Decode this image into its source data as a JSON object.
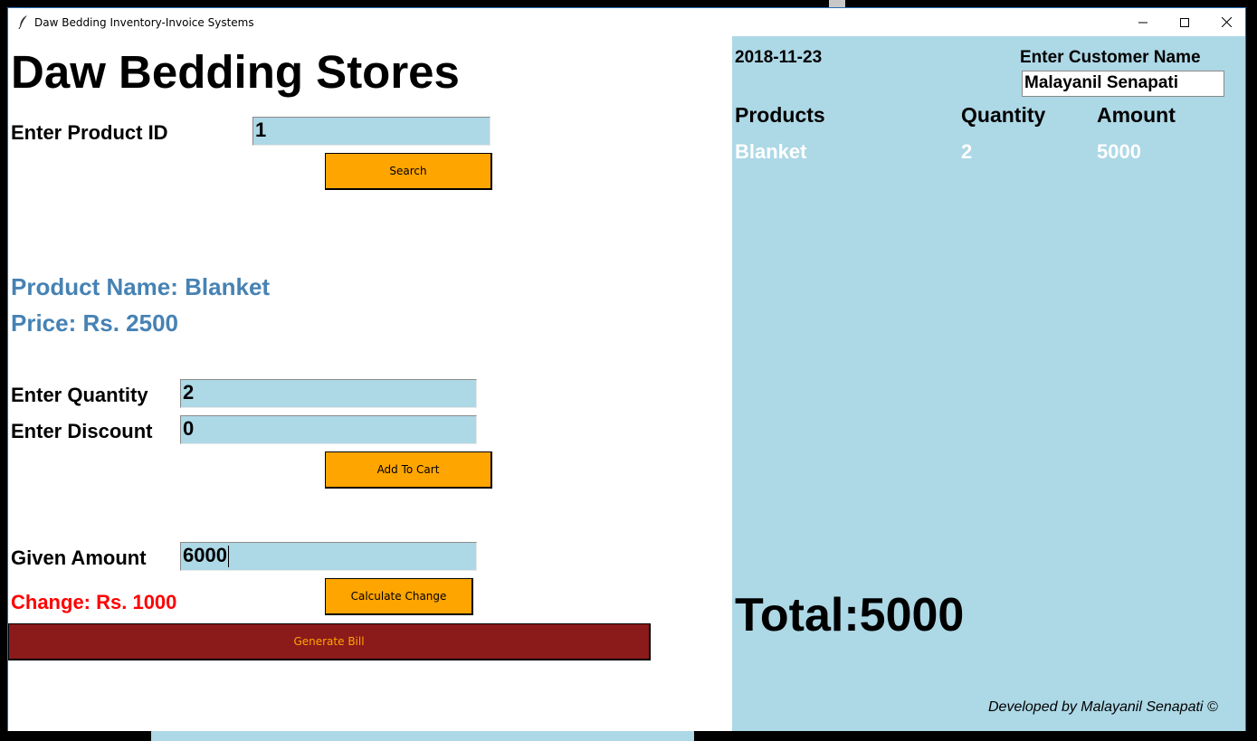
{
  "window": {
    "title": "Daw Bedding Inventory-Invoice Systems",
    "icon": "feather-icon",
    "controls": [
      "minimize-icon",
      "maximize-icon",
      "close-icon"
    ]
  },
  "left": {
    "store_title": "Daw Bedding Stores",
    "product_id_label": "Enter Product ID",
    "product_id_value": "1",
    "search_label": "Search",
    "product_name": "Product Name: Blanket",
    "product_price": "Price: Rs. 2500",
    "quantity_label": "Enter Quantity",
    "quantity_value": "2",
    "discount_label": "Enter Discount",
    "discount_value": "0",
    "add_to_cart_label": "Add To Cart",
    "given_amount_label": "Given Amount",
    "given_amount_value": "6000",
    "change_text": "Change: Rs. 1000",
    "calculate_change_label": "Calculate Change",
    "generate_bill_label": "Generate Bill"
  },
  "right": {
    "date": "2018-11-23",
    "customer_label": "Enter Customer Name",
    "customer_value": "Malayanil Senapati",
    "headers": {
      "products": "Products",
      "quantity": "Quantity",
      "amount": "Amount"
    },
    "rows": [
      {
        "product": "Blanket",
        "quantity": "2",
        "amount": "5000"
      }
    ],
    "total": "Total:5000",
    "credit": "Developed by Malayanil Senapati ©"
  },
  "colors": {
    "panel": "#add8e6",
    "button": "#ffa500",
    "bill_button": "#8b1a1a",
    "product_info": "#4682b4",
    "change": "#ff0000"
  }
}
